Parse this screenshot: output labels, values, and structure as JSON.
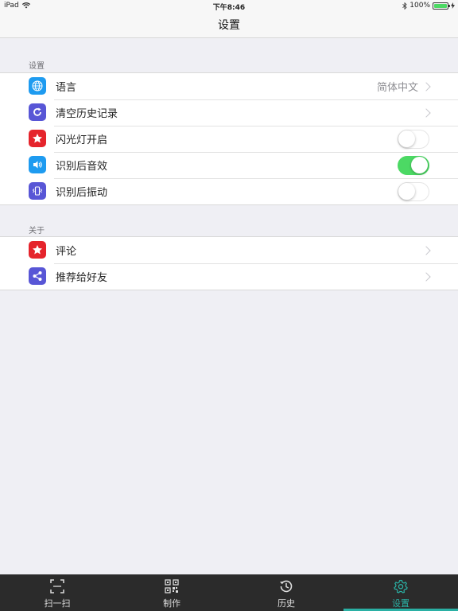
{
  "status_bar": {
    "device": "iPad",
    "time": "下午8:46",
    "battery": "100%"
  },
  "nav": {
    "title": "设置"
  },
  "sections": {
    "settings": {
      "header": "设置",
      "rows": [
        {
          "label": "语言",
          "value": "简体中文",
          "icon": "globe-icon",
          "color": "#1e9bf0"
        },
        {
          "label": "清空历史记录",
          "icon": "refresh-icon",
          "color": "#5856d6"
        },
        {
          "label": "闪光灯开启",
          "icon": "star-icon",
          "color": "#e5242c",
          "toggle": false
        },
        {
          "label": "识别后音效",
          "icon": "speaker-icon",
          "color": "#1e9bf0",
          "toggle": true
        },
        {
          "label": "识别后振动",
          "icon": "vibrate-icon",
          "color": "#5856d6",
          "toggle": false
        }
      ]
    },
    "about": {
      "header": "关于",
      "rows": [
        {
          "label": "评论",
          "icon": "star-icon",
          "color": "#e5242c"
        },
        {
          "label": "推荐给好友",
          "icon": "share-icon",
          "color": "#5856d6"
        }
      ]
    }
  },
  "tabs": [
    {
      "label": "扫一扫",
      "icon": "scan-icon",
      "active": false
    },
    {
      "label": "制作",
      "icon": "qrcode-icon",
      "active": false
    },
    {
      "label": "历史",
      "icon": "history-icon",
      "active": false
    },
    {
      "label": "设置",
      "icon": "gear-icon",
      "active": true
    }
  ],
  "colors": {
    "accent": "#2ab0a4",
    "toggle_on": "#4cd964"
  }
}
